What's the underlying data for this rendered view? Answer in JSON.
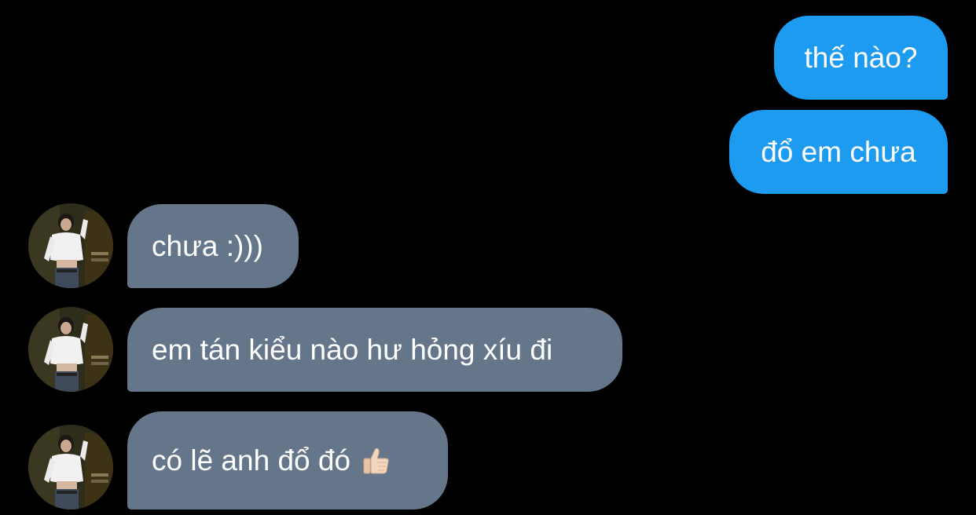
{
  "conversation": {
    "messages": [
      {
        "direction": "sent",
        "text": "thế nào?"
      },
      {
        "direction": "sent",
        "text": "đổ em chưa"
      },
      {
        "direction": "received",
        "text": "chưa :)))"
      },
      {
        "direction": "received",
        "text": "em tán kiểu nào hư hỏng xíu đi"
      },
      {
        "direction": "received",
        "text": "có lẽ anh đổ đó",
        "emoji": "thumbs-up-emoji"
      }
    ]
  },
  "colors": {
    "background": "#000000",
    "sent_bubble": "#1d9bf0",
    "received_bubble": "#66768a",
    "text": "#ffffff"
  },
  "icons": {
    "avatar": "contact-avatar-photo",
    "reaction": "thumbs-up-emoji"
  }
}
